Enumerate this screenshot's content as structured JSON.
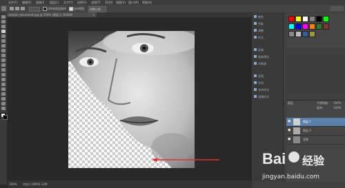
{
  "menu": {
    "items": [
      "文件(F)",
      "编辑(E)",
      "图像(I)",
      "图层(L)",
      "文字(Y)",
      "选择(S)",
      "滤镜(T)",
      "3D(D)",
      "视图(V)",
      "窗口(W)",
      "帮助(H)"
    ]
  },
  "options": {
    "refine_edge": "调整边缘...",
    "auto_enhance": "自动增强"
  },
  "document": {
    "tab_label": "sample_document.jpg @ 100% (图层 0, RGB/8)"
  },
  "collapsed_panels": {
    "items": [
      "颜色",
      "色板",
      "调整",
      "样式",
      "画笔",
      "画笔预设",
      "仿制源",
      "段落",
      "字符",
      "字符样式",
      "段落样式"
    ]
  },
  "layers": {
    "title": "图层",
    "opacity_label": "不透明度:",
    "opacity_value": "100%",
    "fill_label": "填充:",
    "fill_value": "100%",
    "rows": [
      {
        "name": "图层 1",
        "selected": true
      },
      {
        "name": "图层 0",
        "selected": false
      },
      {
        "name": "背景",
        "selected": false
      }
    ]
  },
  "status": {
    "zoom": "100%",
    "doc_info": "文档:1.06M/2.12M"
  },
  "watermark": {
    "brand": "Bai",
    "brand2": "经验",
    "url": "jingyan.baidu.com"
  },
  "colors": {
    "accent_arrow": "#e03030",
    "swatches": [
      "#ff0000",
      "#ffff00",
      "#00ff00",
      "#00ffff",
      "#0000ff",
      "#ff00ff",
      "#ffffff",
      "#808080",
      "#000000",
      "#ff8000"
    ]
  }
}
